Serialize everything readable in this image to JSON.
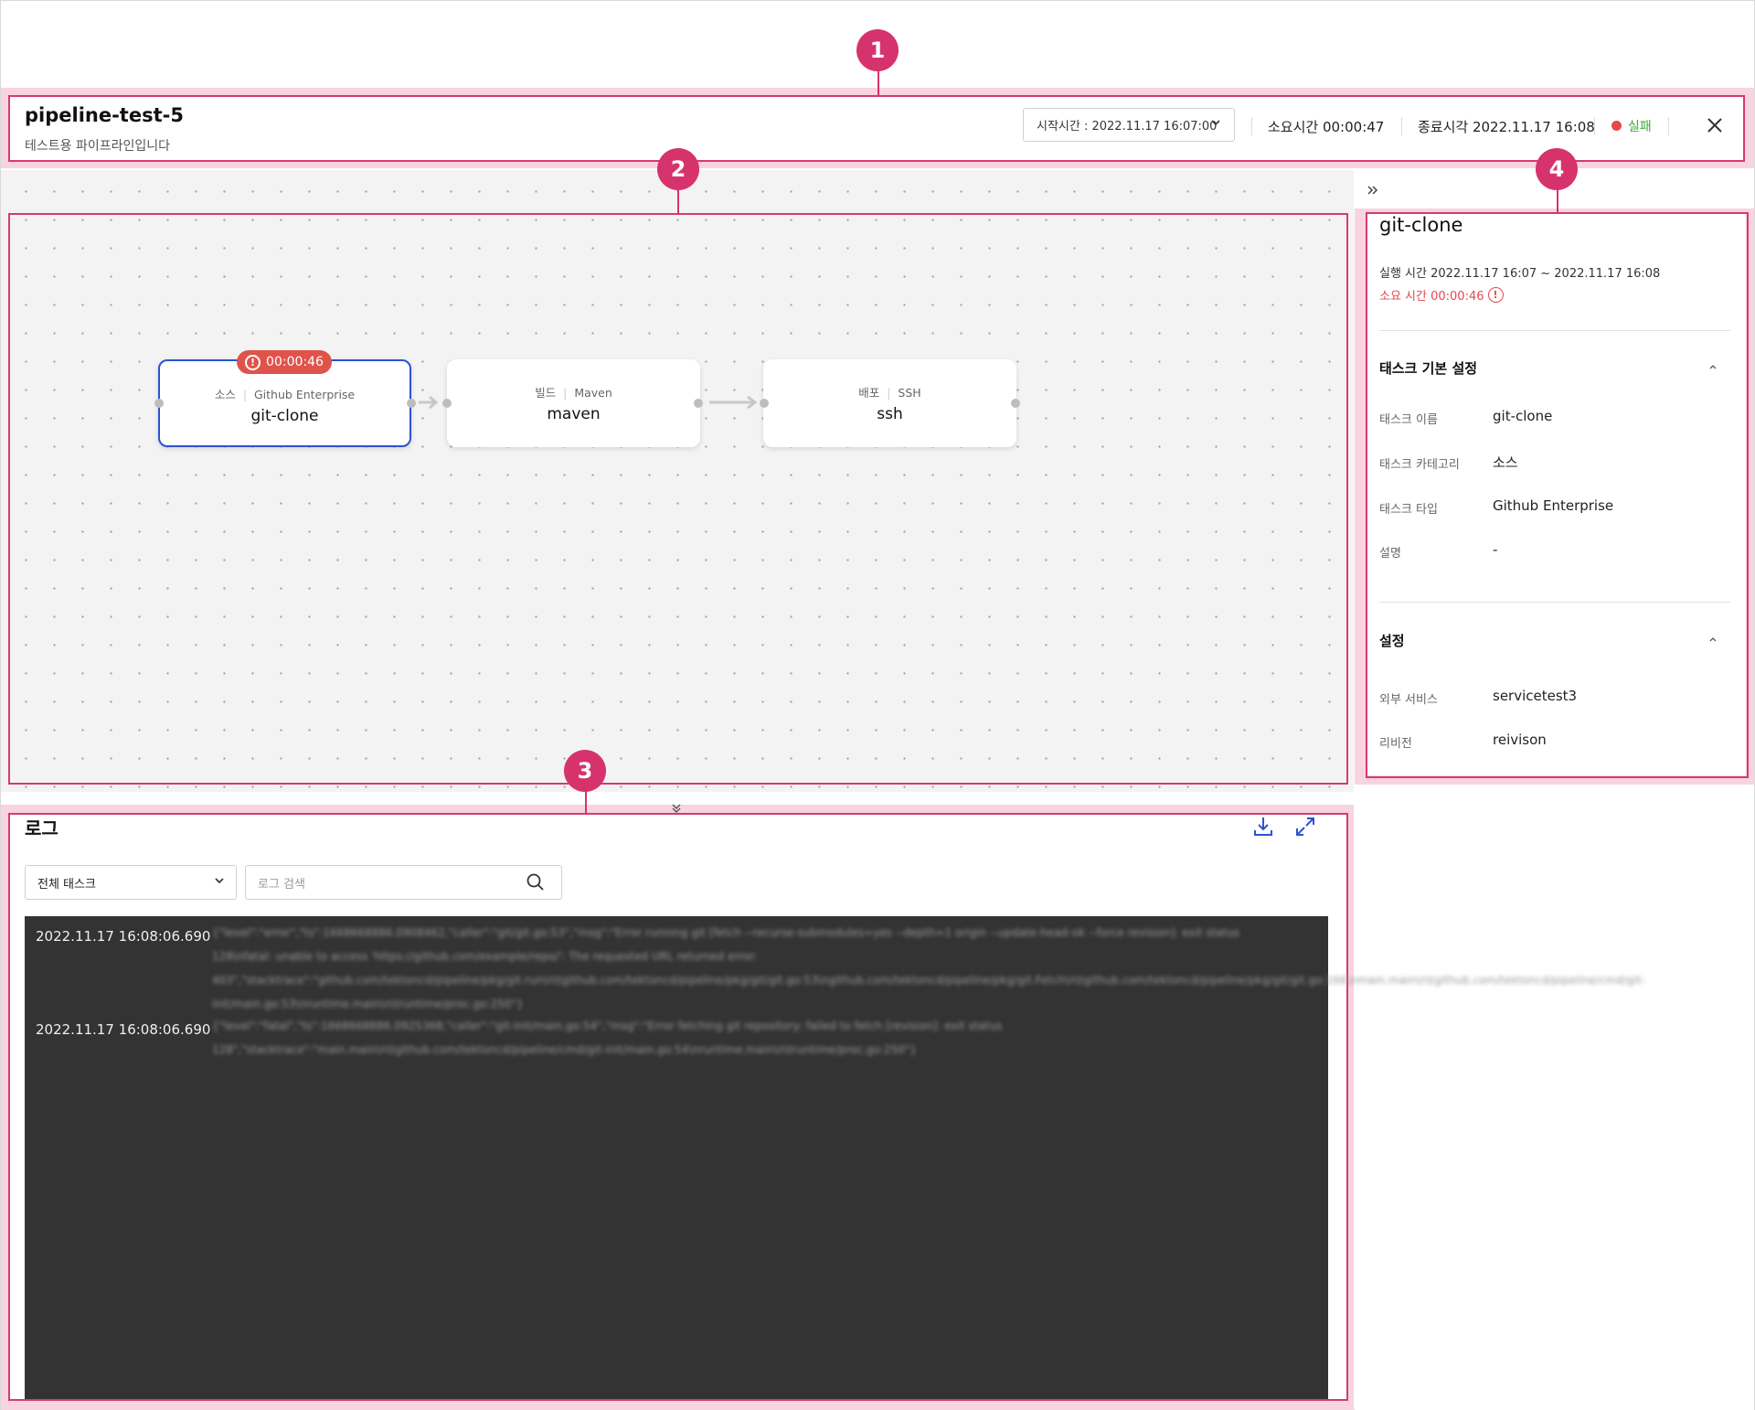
{
  "header": {
    "title": "pipeline-test-5",
    "subtitle": "테스트용 파이프라인입니다",
    "start_select": "시작시간 : 2022.11.17 16:07:00",
    "duration": "소요시간 00:00:47",
    "end_time": "종료시각 2022.11.17 16:08",
    "status": "실패"
  },
  "markers": [
    "1",
    "2",
    "3",
    "4"
  ],
  "pipeline": {
    "nodes": [
      {
        "category": "소스",
        "type": "Github Enterprise",
        "name": "git-clone",
        "badge": "00:00:46"
      },
      {
        "category": "빌드",
        "type": "Maven",
        "name": "maven"
      },
      {
        "category": "배포",
        "type": "SSH",
        "name": "ssh"
      }
    ]
  },
  "detail": {
    "title": "git-clone",
    "run_time": "실행 시간 2022.11.17 16:07 ~ 2022.11.17 16:08",
    "elapsed": "소요 시간 00:00:46",
    "section_basic": "태스크 기본 설정",
    "basic": [
      {
        "label": "태스크 이름",
        "value": "git-clone"
      },
      {
        "label": "태스크 카테고리",
        "value": "소스"
      },
      {
        "label": "태스크 타입",
        "value": "Github Enterprise"
      },
      {
        "label": "설명",
        "value": "-"
      }
    ],
    "section_settings": "설정",
    "settings": [
      {
        "label": "외부 서비스",
        "value": "servicetest3"
      },
      {
        "label": "리비전",
        "value": "reivison"
      }
    ]
  },
  "log": {
    "title": "로그",
    "task_select": "전체 태스크",
    "search_placeholder": "로그 검색",
    "entries": [
      {
        "time": "2022.11.17 16:08:06.690",
        "message": "{\"level\":\"error\",\"ts\":1668668886.0908462,\"caller\":\"git/git.go:53\",\"msg\":\"Error running git [fetch --recurse-submodules=yes --depth=1 origin --update-head-ok --force revision]: exit status 128\\nfatal: unable to access 'https://github.com/example/repo/': The requested URL returned error: 403\",\"stacktrace\":\"github.com/tektoncd/pipeline/pkg/git.run\\n\\tgithub.com/tektoncd/pipeline/pkg/git/git.go:53\\ngithub.com/tektoncd/pipeline/pkg/git.Fetch\\n\\tgithub.com/tektoncd/pipeline/pkg/git/git.go:166\\nmain.main\\n\\tgithub.com/tektoncd/pipeline/cmd/git-init/main.go:53\\nruntime.main\\n\\truntime/proc.go:250\"}"
      },
      {
        "time": "2022.11.17 16:08:06.690",
        "message": "{\"level\":\"fatal\",\"ts\":1668668886.0925368,\"caller\":\"git-init/main.go:54\",\"msg\":\"Error fetching git repository: failed to fetch [revision]: exit status 128\",\"stacktrace\":\"main.main\\n\\tgithub.com/tektoncd/pipeline/cmd/git-init/main.go:54\\nruntime.main\\n\\truntime/proc.go:250\"}"
      }
    ]
  },
  "colors": {
    "highlight": "#d63a70",
    "highlight_band": "#f7d4df",
    "selected_node": "#2c52d4",
    "error": "#e0534b",
    "status_ok_text": "#3aaa35",
    "console_bg": "#333333"
  },
  "icons": [
    "close-icon",
    "error-icon",
    "expand-panel-icon",
    "collapse-down-icon",
    "download-icon",
    "fullscreen-icon",
    "search-icon",
    "chevron-down-icon",
    "chevron-up-icon"
  ]
}
